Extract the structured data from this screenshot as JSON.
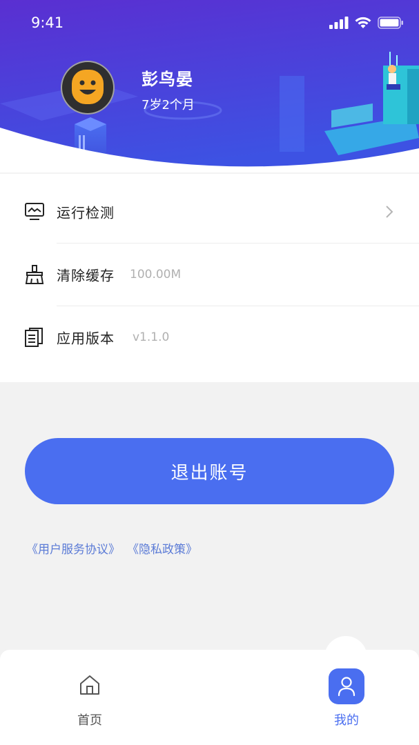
{
  "status_bar": {
    "time": "9:41"
  },
  "profile": {
    "name": "彭鸟晏",
    "age": "7岁2个月"
  },
  "menu": {
    "items": [
      {
        "label": "运行检测",
        "value": ""
      },
      {
        "label": "清除缓存",
        "value": "100.00M"
      },
      {
        "label": "应用版本",
        "value": "v1.1.0"
      }
    ]
  },
  "logout_label": "退出账号",
  "links": {
    "agreement": "《用户服务协议》",
    "privacy": "《隐私政策》"
  },
  "tabbar": {
    "home_label": "首页",
    "mine_label": "我的"
  },
  "colors": {
    "accent": "#4a6ef0",
    "header_top": "#5a2fd1",
    "header_bottom": "#3f4fe0"
  }
}
